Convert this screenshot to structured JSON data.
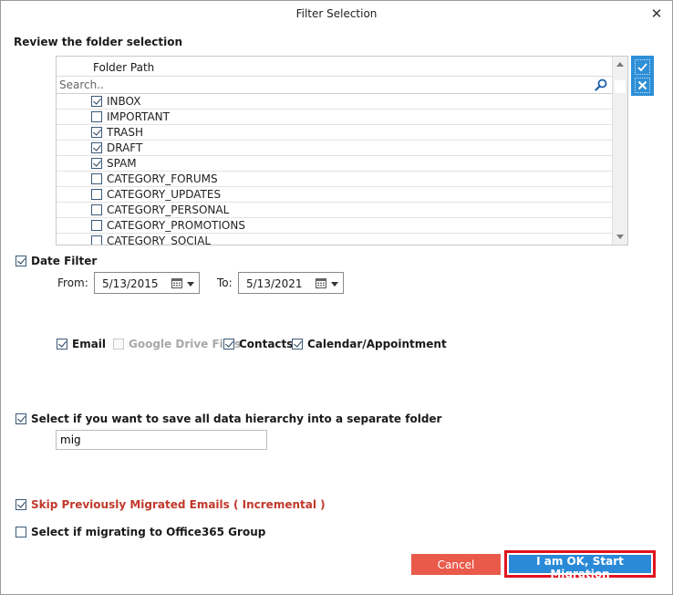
{
  "window": {
    "title": "Filter Selection"
  },
  "folder_section": {
    "heading": "Review the folder selection"
  },
  "folder_grid": {
    "column_header": "Folder Path",
    "search_placeholder": "Search..",
    "folders": [
      {
        "name": "INBOX",
        "checked": true
      },
      {
        "name": "IMPORTANT",
        "checked": false
      },
      {
        "name": "TRASH",
        "checked": true
      },
      {
        "name": "DRAFT",
        "checked": true
      },
      {
        "name": "SPAM",
        "checked": true
      },
      {
        "name": "CATEGORY_FORUMS",
        "checked": false
      },
      {
        "name": "CATEGORY_UPDATES",
        "checked": false
      },
      {
        "name": "CATEGORY_PERSONAL",
        "checked": false
      },
      {
        "name": "CATEGORY_PROMOTIONS",
        "checked": false
      },
      {
        "name": "CATEGORY_SOCIAL",
        "checked": false
      }
    ],
    "side_tools": [
      "select-all-icon",
      "deselect-all-icon"
    ]
  },
  "date_filter": {
    "label": "Date Filter",
    "checked": true,
    "from_label": "From:",
    "from_value": "5/13/2015",
    "to_label": "To:",
    "to_value": "5/13/2021"
  },
  "item_types": [
    {
      "label": "Email",
      "checked": true,
      "disabled": false
    },
    {
      "label": "Google Drive Files",
      "checked": false,
      "disabled": true
    },
    {
      "label": "Contacts",
      "checked": true,
      "disabled": false
    },
    {
      "label": "Calendar/Appointment",
      "checked": true,
      "disabled": false
    }
  ],
  "hierarchy": {
    "label": "Select if you want to save all data hierarchy into a separate folder",
    "checked": true,
    "folder_name": "mig"
  },
  "incremental": {
    "label": "Skip Previously Migrated Emails ( Incremental )",
    "checked": true,
    "color": "#c0392b"
  },
  "office365_group": {
    "label": "Select if migrating to Office365 Group",
    "checked": false
  },
  "buttons": {
    "cancel": "Cancel",
    "start": "I am OK, Start Migration"
  },
  "colors": {
    "accent": "#2a8ad8",
    "cancel": "#e95a4b",
    "highlight_border": "#e0121f"
  }
}
